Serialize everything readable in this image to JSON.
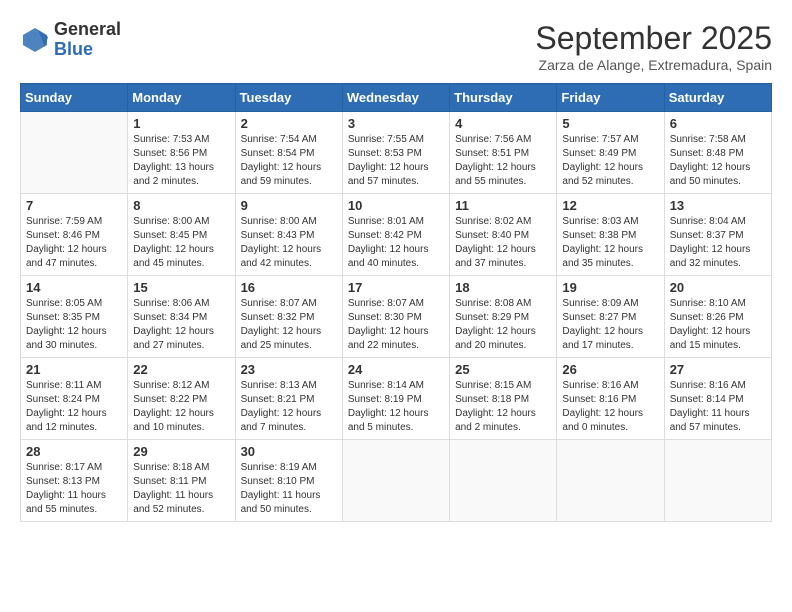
{
  "logo": {
    "general": "General",
    "blue": "Blue"
  },
  "title": "September 2025",
  "subtitle": "Zarza de Alange, Extremadura, Spain",
  "days": [
    "Sunday",
    "Monday",
    "Tuesday",
    "Wednesday",
    "Thursday",
    "Friday",
    "Saturday"
  ],
  "weeks": [
    [
      {
        "day": "",
        "content": ""
      },
      {
        "day": "1",
        "content": "Sunrise: 7:53 AM\nSunset: 8:56 PM\nDaylight: 13 hours and 2 minutes."
      },
      {
        "day": "2",
        "content": "Sunrise: 7:54 AM\nSunset: 8:54 PM\nDaylight: 12 hours and 59 minutes."
      },
      {
        "day": "3",
        "content": "Sunrise: 7:55 AM\nSunset: 8:53 PM\nDaylight: 12 hours and 57 minutes."
      },
      {
        "day": "4",
        "content": "Sunrise: 7:56 AM\nSunset: 8:51 PM\nDaylight: 12 hours and 55 minutes."
      },
      {
        "day": "5",
        "content": "Sunrise: 7:57 AM\nSunset: 8:49 PM\nDaylight: 12 hours and 52 minutes."
      },
      {
        "day": "6",
        "content": "Sunrise: 7:58 AM\nSunset: 8:48 PM\nDaylight: 12 hours and 50 minutes."
      }
    ],
    [
      {
        "day": "7",
        "content": "Sunrise: 7:59 AM\nSunset: 8:46 PM\nDaylight: 12 hours and 47 minutes."
      },
      {
        "day": "8",
        "content": "Sunrise: 8:00 AM\nSunset: 8:45 PM\nDaylight: 12 hours and 45 minutes."
      },
      {
        "day": "9",
        "content": "Sunrise: 8:00 AM\nSunset: 8:43 PM\nDaylight: 12 hours and 42 minutes."
      },
      {
        "day": "10",
        "content": "Sunrise: 8:01 AM\nSunset: 8:42 PM\nDaylight: 12 hours and 40 minutes."
      },
      {
        "day": "11",
        "content": "Sunrise: 8:02 AM\nSunset: 8:40 PM\nDaylight: 12 hours and 37 minutes."
      },
      {
        "day": "12",
        "content": "Sunrise: 8:03 AM\nSunset: 8:38 PM\nDaylight: 12 hours and 35 minutes."
      },
      {
        "day": "13",
        "content": "Sunrise: 8:04 AM\nSunset: 8:37 PM\nDaylight: 12 hours and 32 minutes."
      }
    ],
    [
      {
        "day": "14",
        "content": "Sunrise: 8:05 AM\nSunset: 8:35 PM\nDaylight: 12 hours and 30 minutes."
      },
      {
        "day": "15",
        "content": "Sunrise: 8:06 AM\nSunset: 8:34 PM\nDaylight: 12 hours and 27 minutes."
      },
      {
        "day": "16",
        "content": "Sunrise: 8:07 AM\nSunset: 8:32 PM\nDaylight: 12 hours and 25 minutes."
      },
      {
        "day": "17",
        "content": "Sunrise: 8:07 AM\nSunset: 8:30 PM\nDaylight: 12 hours and 22 minutes."
      },
      {
        "day": "18",
        "content": "Sunrise: 8:08 AM\nSunset: 8:29 PM\nDaylight: 12 hours and 20 minutes."
      },
      {
        "day": "19",
        "content": "Sunrise: 8:09 AM\nSunset: 8:27 PM\nDaylight: 12 hours and 17 minutes."
      },
      {
        "day": "20",
        "content": "Sunrise: 8:10 AM\nSunset: 8:26 PM\nDaylight: 12 hours and 15 minutes."
      }
    ],
    [
      {
        "day": "21",
        "content": "Sunrise: 8:11 AM\nSunset: 8:24 PM\nDaylight: 12 hours and 12 minutes."
      },
      {
        "day": "22",
        "content": "Sunrise: 8:12 AM\nSunset: 8:22 PM\nDaylight: 12 hours and 10 minutes."
      },
      {
        "day": "23",
        "content": "Sunrise: 8:13 AM\nSunset: 8:21 PM\nDaylight: 12 hours and 7 minutes."
      },
      {
        "day": "24",
        "content": "Sunrise: 8:14 AM\nSunset: 8:19 PM\nDaylight: 12 hours and 5 minutes."
      },
      {
        "day": "25",
        "content": "Sunrise: 8:15 AM\nSunset: 8:18 PM\nDaylight: 12 hours and 2 minutes."
      },
      {
        "day": "26",
        "content": "Sunrise: 8:16 AM\nSunset: 8:16 PM\nDaylight: 12 hours and 0 minutes."
      },
      {
        "day": "27",
        "content": "Sunrise: 8:16 AM\nSunset: 8:14 PM\nDaylight: 11 hours and 57 minutes."
      }
    ],
    [
      {
        "day": "28",
        "content": "Sunrise: 8:17 AM\nSunset: 8:13 PM\nDaylight: 11 hours and 55 minutes."
      },
      {
        "day": "29",
        "content": "Sunrise: 8:18 AM\nSunset: 8:11 PM\nDaylight: 11 hours and 52 minutes."
      },
      {
        "day": "30",
        "content": "Sunrise: 8:19 AM\nSunset: 8:10 PM\nDaylight: 11 hours and 50 minutes."
      },
      {
        "day": "",
        "content": ""
      },
      {
        "day": "",
        "content": ""
      },
      {
        "day": "",
        "content": ""
      },
      {
        "day": "",
        "content": ""
      }
    ]
  ]
}
